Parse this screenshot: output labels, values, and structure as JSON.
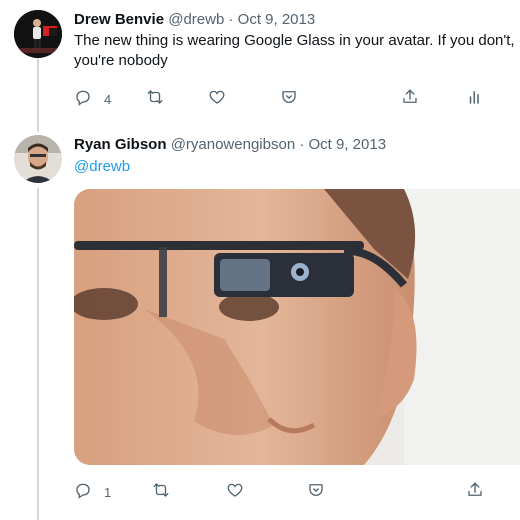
{
  "tweets": [
    {
      "name": "Drew Benvie",
      "handle": "@drewb",
      "dot": "·",
      "date": "Oct 9, 2013",
      "text": "The new thing is wearing Google Glass in your avatar. If you don't, you're nobody",
      "actions": {
        "reply_count": "4"
      }
    },
    {
      "name": "Ryan Gibson",
      "handle": "@ryanowengibson",
      "dot": "·",
      "date": "Oct 9, 2013",
      "reply_to": "@drewb",
      "actions": {
        "reply_count": "1"
      }
    }
  ],
  "icons": [
    "reply-icon",
    "retweet-icon",
    "like-icon",
    "save-icon",
    "share-icon",
    "analytics-icon"
  ],
  "colors": {
    "text": "#0f1419",
    "secondary": "#536471",
    "accent": "#1d9bf0",
    "line": "#cfd9de"
  }
}
